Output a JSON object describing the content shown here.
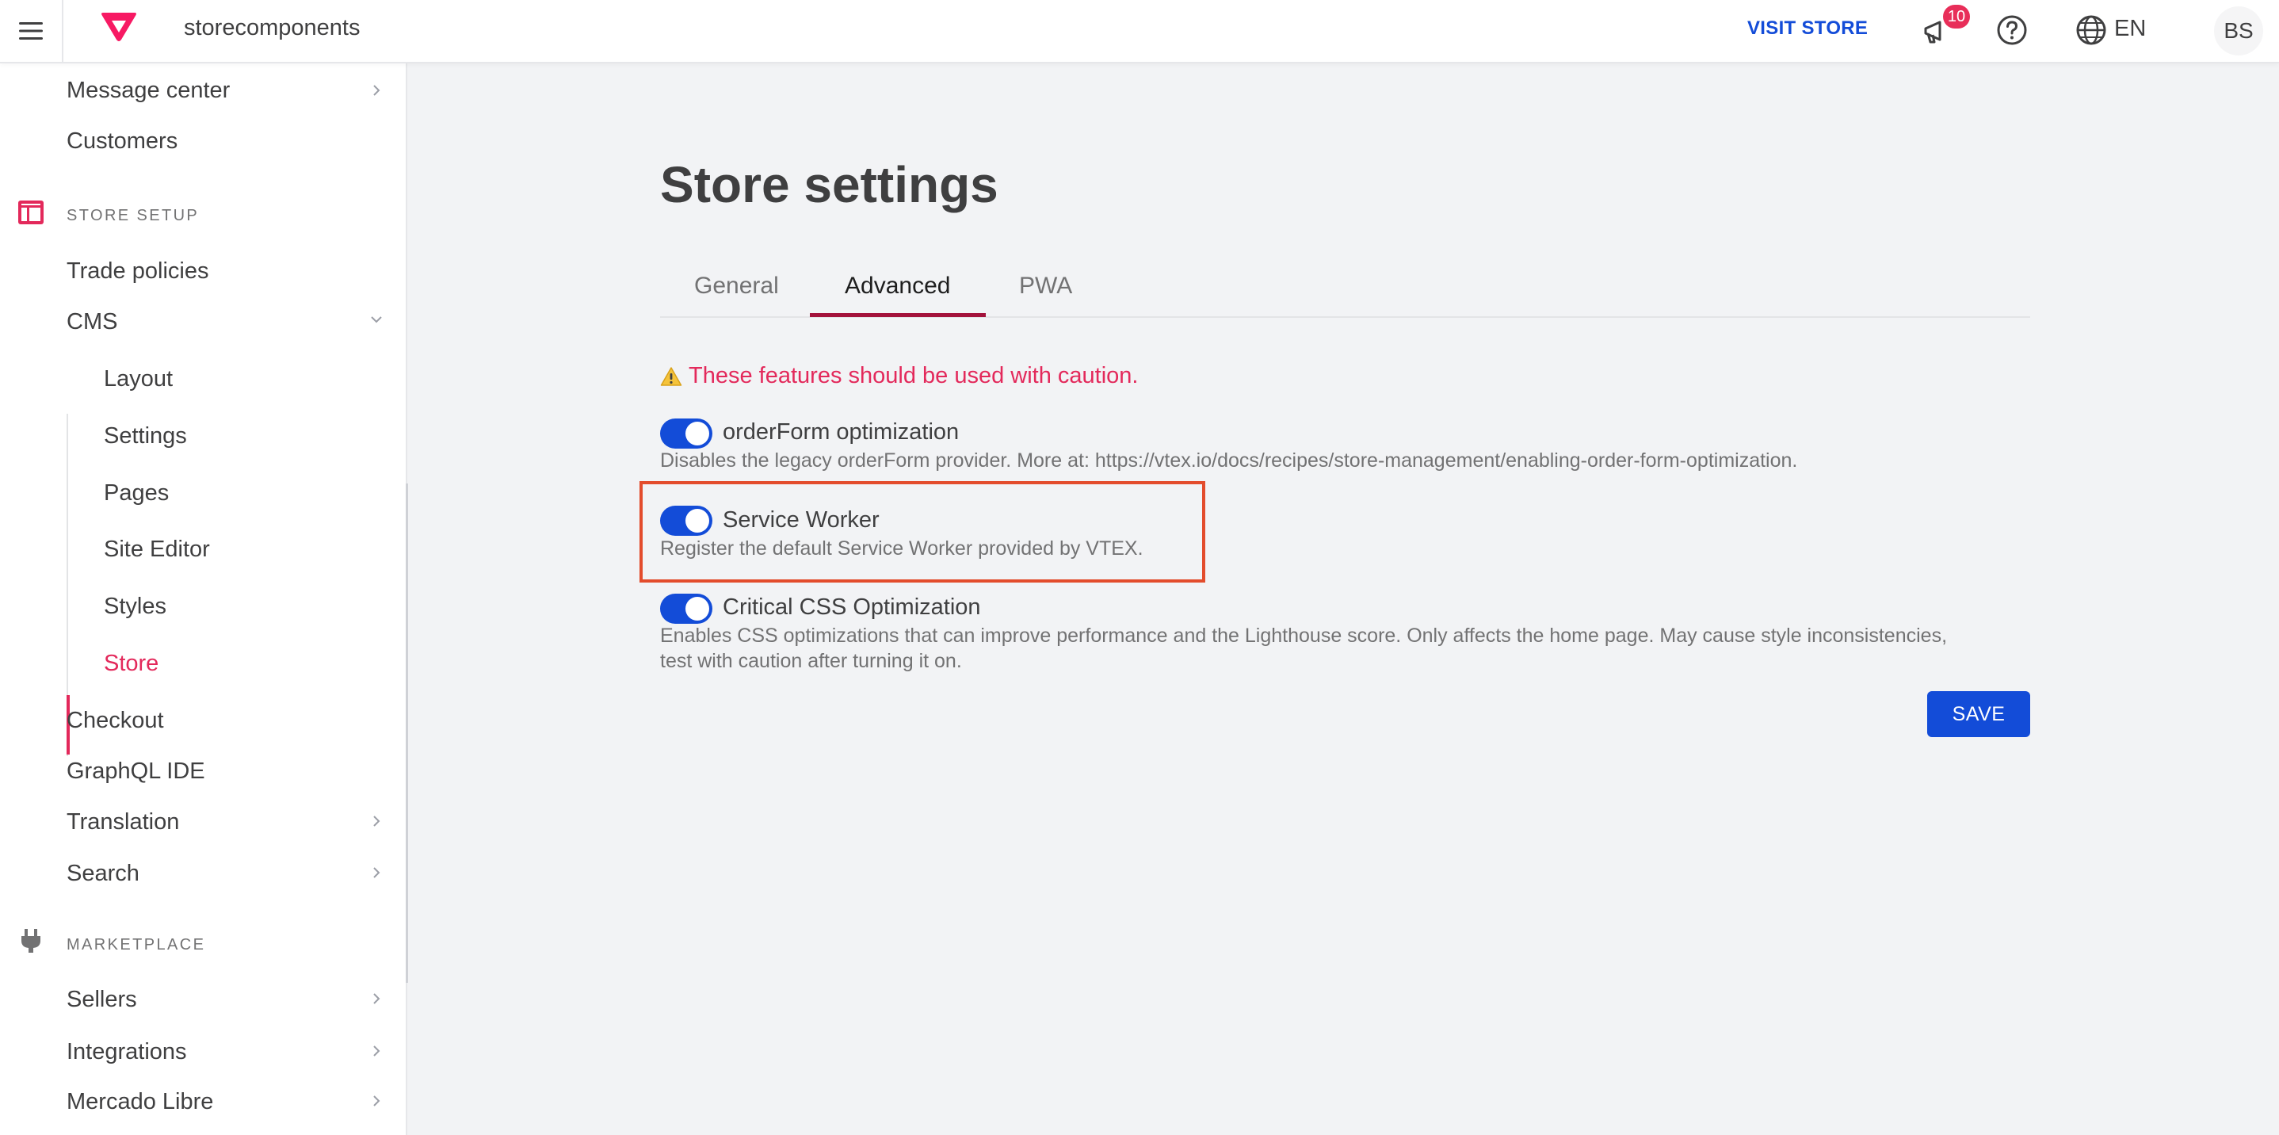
{
  "topbar": {
    "account_name": "storecomponents",
    "visit_store": "VISIT STORE",
    "notifications_count": "10",
    "language": "EN",
    "avatar_initials": "BS"
  },
  "sidebar": {
    "items": [
      {
        "label": "Message center",
        "has_chevron": true
      },
      {
        "label": "Customers"
      }
    ],
    "store_setup": {
      "section_label": "STORE SETUP",
      "trade_policies": "Trade policies",
      "cms": "CMS",
      "cms_children": [
        "Layout",
        "Settings",
        "Pages",
        "Site Editor",
        "Styles",
        "Store"
      ],
      "active_child": "Store",
      "checkout": "Checkout",
      "graphql_ide": "GraphQL IDE",
      "translation": "Translation",
      "search": "Search"
    },
    "marketplace": {
      "section_label": "MARKETPLACE",
      "sellers": "Sellers",
      "integrations": "Integrations",
      "mercado_libre": "Mercado Libre"
    }
  },
  "main": {
    "title": "Store settings",
    "tabs": [
      {
        "label": "General"
      },
      {
        "label": "Advanced",
        "active": true
      },
      {
        "label": "PWA"
      }
    ],
    "caution_text": "These features should be used with caution.",
    "options": [
      {
        "label": "orderForm optimization",
        "description": "Disables the legacy orderForm provider. More at: https://vtex.io/docs/recipes/store-management/enabling-order-form-optimization.",
        "enabled": true
      },
      {
        "label": "Service Worker",
        "description": "Register the default Service Worker provided by VTEX.",
        "enabled": true
      },
      {
        "label": "Critical CSS Optimization",
        "description_line1": "Enables CSS optimizations that can improve performance and the Lighthouse score. Only affects the home page. May cause style inconsistencies,",
        "description_line2": "test with caution after turning it on.",
        "enabled": true
      }
    ],
    "save_label": "SAVE"
  },
  "colors": {
    "accent_pink": "#e3295b",
    "primary_blue": "#134cd8",
    "highlight_red": "#e34c2c",
    "tab_underline": "#a3123b"
  }
}
